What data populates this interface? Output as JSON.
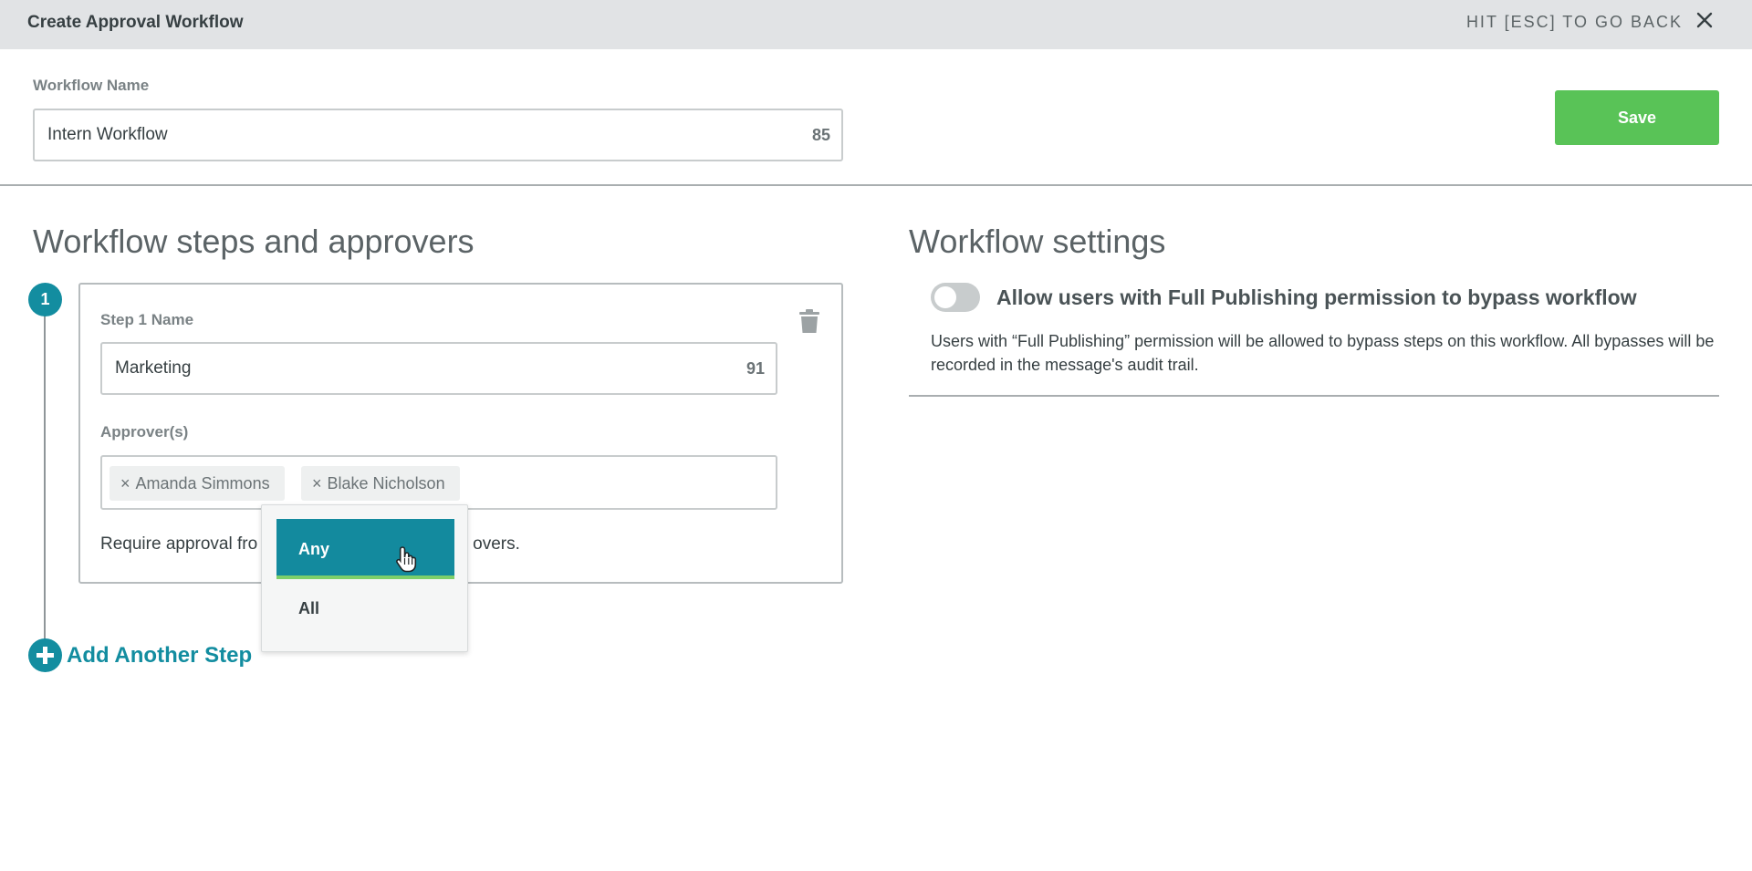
{
  "topbar": {
    "title": "Create Approval Workflow",
    "esc_hint": "HIT [ESC] TO GO BACK"
  },
  "header": {
    "workflow_name_label": "Workflow Name",
    "workflow_name_value": "Intern Workflow",
    "workflow_name_count": "85",
    "save_label": "Save"
  },
  "steps": {
    "title": "Workflow steps and approvers",
    "items": [
      {
        "number": "1",
        "name_label": "Step 1 Name",
        "name_value": "Marketing",
        "name_count": "91",
        "approvers_label": "Approver(s)",
        "approvers": [
          "Amanda Simmons",
          "Blake Nicholson"
        ],
        "require_prefix": "Require approval fro",
        "require_suffix": "overs."
      }
    ],
    "dropdown": {
      "options": [
        "Any",
        "All"
      ],
      "selected": "Any"
    },
    "add_step_label": "Add Another Step"
  },
  "settings": {
    "title": "Workflow settings",
    "bypass_label": "Allow users with Full Publishing permission to bypass workflow",
    "bypass_enabled": false,
    "bypass_description": "Users with “Full Publishing” permission will be allowed to bypass steps on this workflow. All bypasses will be recorded in the message's audit trail."
  },
  "colors": {
    "accent": "#138da0",
    "save": "#59c357",
    "topbar": "#e1e3e5"
  },
  "icons": {
    "close": "close-icon",
    "trash": "trash-icon",
    "plus": "plus-circle-icon",
    "cursor": "hand-pointer-icon"
  }
}
